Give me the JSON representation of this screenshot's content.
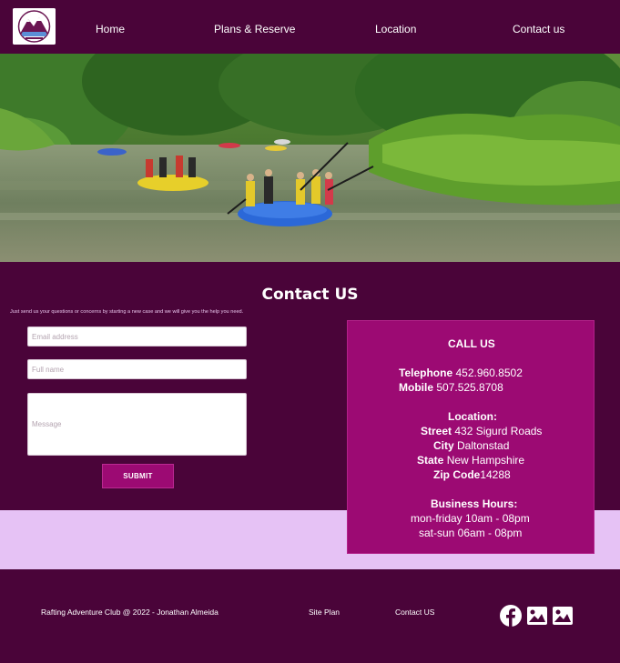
{
  "nav": {
    "logo_icon": "rafting-club-logo-icon",
    "links": [
      "Home",
      "Plans & Reserve",
      "Location",
      "Contact us"
    ]
  },
  "hero": {
    "image": "river-rafting-photo"
  },
  "contact": {
    "title": "Contact US",
    "intro": "Just send us your questions or concerns by starting a new case and we will give you the help you need.",
    "email_placeholder": "Email address",
    "name_placeholder": "Full name",
    "message_placeholder": "Message",
    "submit_label": "SUBMIT"
  },
  "call": {
    "heading": "CALL US",
    "telephone_label": "Telephone",
    "telephone": "452.960.8502",
    "mobile_label": "Mobile",
    "mobile": "507.525.8708",
    "location_heading": "Location:",
    "street_label": "Street",
    "street": "432 Sigurd Roads",
    "city_label": "City",
    "city": "Daltonstad",
    "state_label": "State",
    "state": "New Hampshire",
    "zip_label": "Zip Code",
    "zip": "14288",
    "hours_heading": "Business Hours:",
    "weekday_hours": "mon-friday 10am - 08pm",
    "weekend_hours": "sat-sun 06am - 08pm"
  },
  "footer": {
    "copyright": "Rafting Adventure Club @ 2022 - Jonathan  Almeida",
    "site_plan": "Site Plan",
    "contact_link": "Contact US",
    "social_icons": [
      "facebook-icon",
      "image-icon",
      "image-icon"
    ]
  },
  "colors": {
    "primary": "#4a0439",
    "accent": "#9c0a73",
    "band": "#e6c2f5"
  }
}
